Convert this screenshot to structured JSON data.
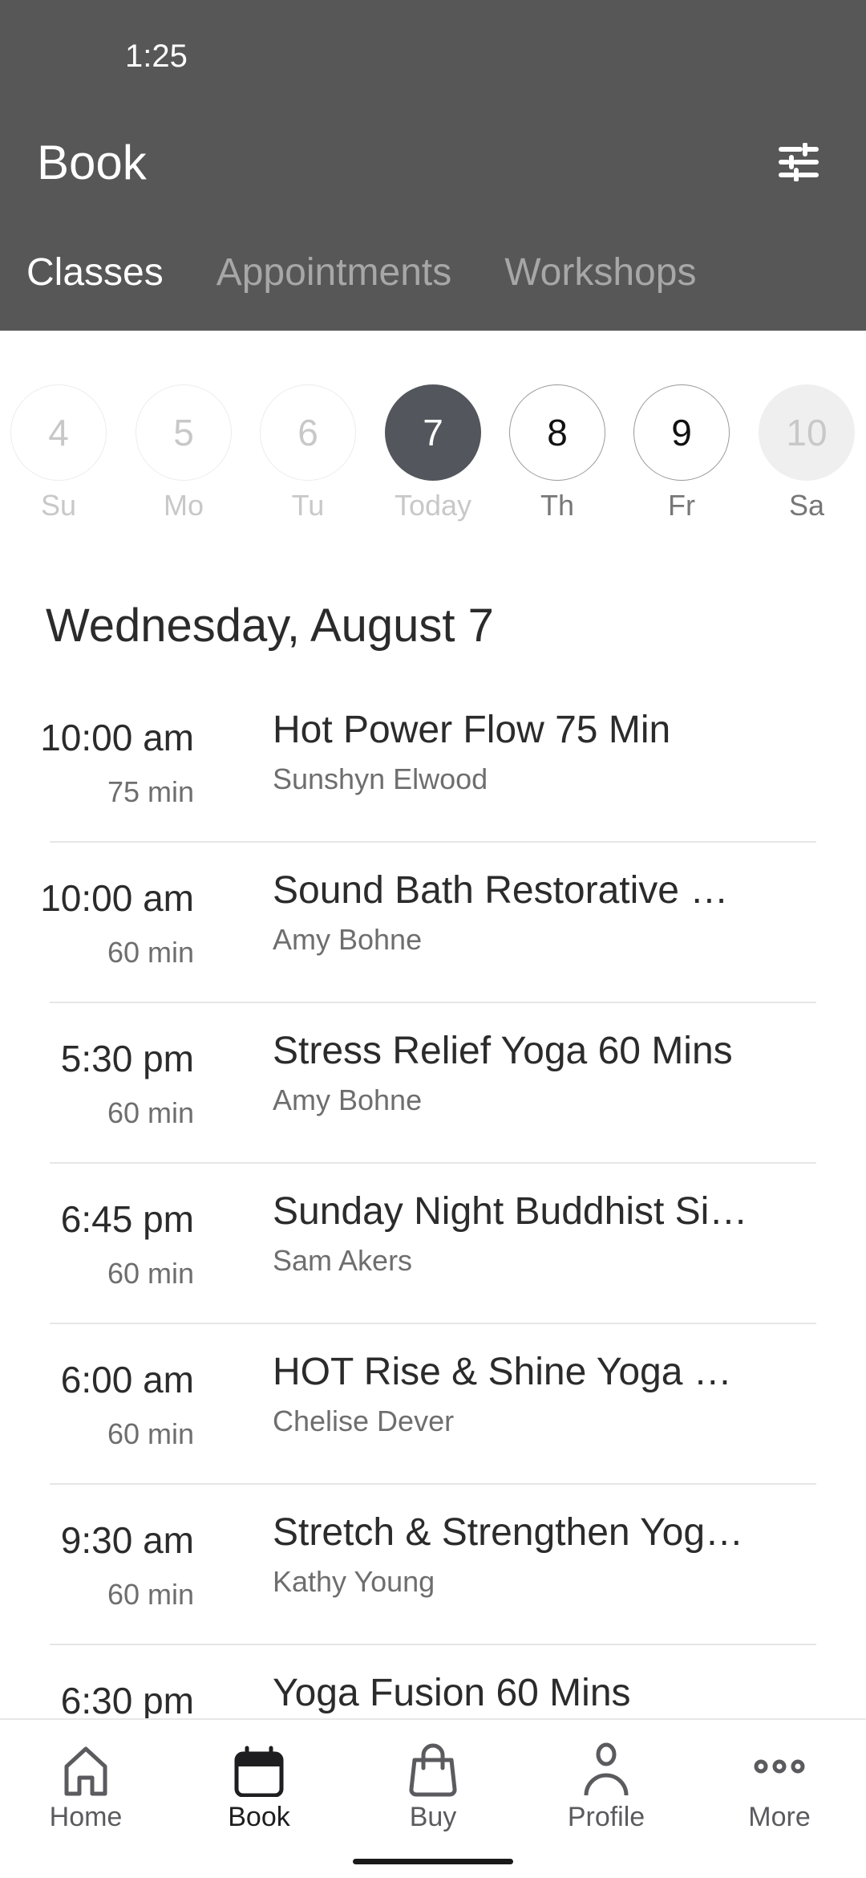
{
  "status_bar": {
    "time": "1:25"
  },
  "header": {
    "title": "Book",
    "filter_icon": "sliders-icon",
    "tabs": [
      {
        "label": "Classes",
        "active": true
      },
      {
        "label": "Appointments",
        "active": false
      },
      {
        "label": "Workshops",
        "active": false
      }
    ]
  },
  "week": {
    "days": [
      {
        "number": "4",
        "label": "Su",
        "state": "past"
      },
      {
        "number": "5",
        "label": "Mo",
        "state": "past"
      },
      {
        "number": "6",
        "label": "Tu",
        "state": "past"
      },
      {
        "number": "7",
        "label": "Today",
        "state": "selected"
      },
      {
        "number": "8",
        "label": "Th",
        "state": "future"
      },
      {
        "number": "9",
        "label": "Fr",
        "state": "future"
      },
      {
        "number": "10",
        "label": "Sa",
        "state": "disabled"
      }
    ]
  },
  "schedule": {
    "date_heading": "Wednesday, August 7",
    "classes": [
      {
        "time": "10:00 am",
        "duration": "75 min",
        "title": "Hot Power Flow 75 Min",
        "instructor": "Sunshyn Elwood"
      },
      {
        "time": "10:00 am",
        "duration": "60 min",
        "title": "Sound Bath Restorative …",
        "instructor": "Amy Bohne"
      },
      {
        "time": "5:30 pm",
        "duration": "60 min",
        "title": "Stress Relief Yoga 60 Mins",
        "instructor": "Amy Bohne"
      },
      {
        "time": "6:45 pm",
        "duration": "60 min",
        "title": "Sunday Night Buddhist Si…",
        "instructor": "Sam Akers"
      },
      {
        "time": "6:00 am",
        "duration": "60 min",
        "title": "HOT Rise & Shine Yoga …",
        "instructor": "Chelise Dever"
      },
      {
        "time": "9:30 am",
        "duration": "60 min",
        "title": "Stretch & Strengthen Yog…",
        "instructor": "Kathy Young"
      },
      {
        "time": "6:30 pm",
        "duration": "",
        "title": "Yoga Fusion 60 Mins",
        "instructor": ""
      }
    ]
  },
  "bottom_nav": {
    "items": [
      {
        "label": "Home",
        "icon": "home-icon",
        "active": false
      },
      {
        "label": "Book",
        "icon": "calendar-icon",
        "active": true
      },
      {
        "label": "Buy",
        "icon": "shopping-bag-icon",
        "active": false
      },
      {
        "label": "Profile",
        "icon": "person-icon",
        "active": false
      },
      {
        "label": "More",
        "icon": "more-dots-icon",
        "active": false
      }
    ]
  },
  "colors": {
    "header_bg": "#575757",
    "selected_day": "#53565c",
    "text_primary": "#2b2b2b",
    "text_secondary": "#6e6e6e"
  }
}
